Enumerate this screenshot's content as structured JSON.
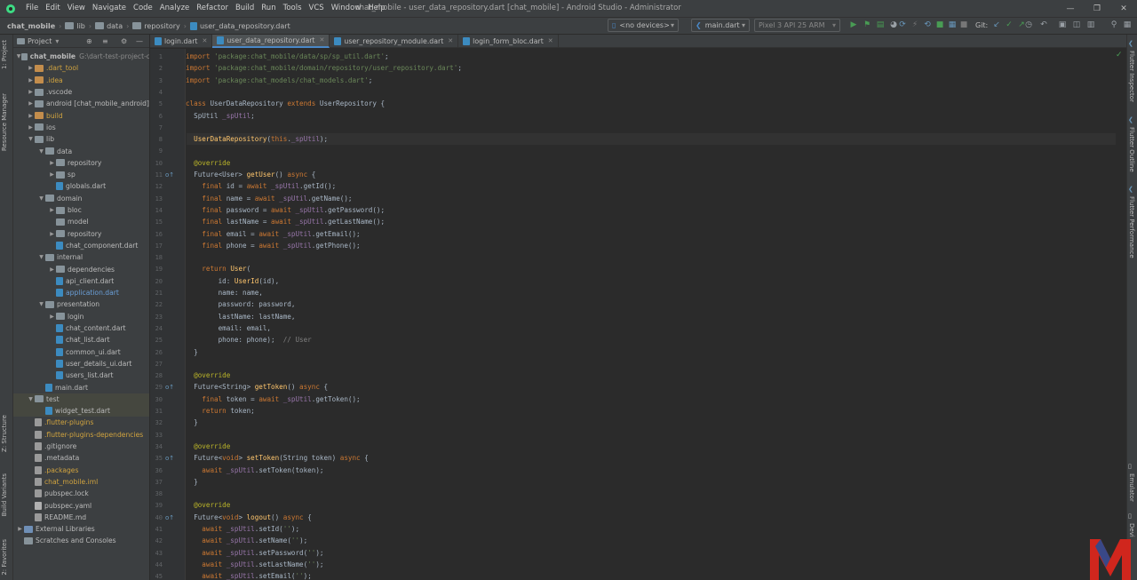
{
  "menubar": {
    "items": [
      "File",
      "Edit",
      "View",
      "Navigate",
      "Code",
      "Analyze",
      "Refactor",
      "Build",
      "Run",
      "Tools",
      "VCS",
      "Window",
      "Help"
    ],
    "title": "chat_mobile - user_data_repository.dart [chat_mobile] - Android Studio - Administrator"
  },
  "breadcrumb": [
    "chat_mobile",
    "lib",
    "data",
    "repository",
    "user_data_repository.dart"
  ],
  "toolbar": {
    "device_combo": "<no devices>",
    "config_combo": "main.dart",
    "avd_combo": "Pixel 3 API 25 ARM",
    "git_label": "Git:"
  },
  "project_panel": {
    "title": "Project",
    "tree": [
      {
        "label": "chat_mobile",
        "suffix": "G:\\dart-test-project-c",
        "indent": 0,
        "arrow": "down",
        "icon": "folder",
        "tone": "root"
      },
      {
        "label": ".dart_tool",
        "indent": 1,
        "arrow": "right",
        "icon": "folder-orange",
        "tone": "orange"
      },
      {
        "label": ".idea",
        "indent": 1,
        "arrow": "right",
        "icon": "folder-orange",
        "tone": "orange"
      },
      {
        "label": ".vscode",
        "indent": 1,
        "arrow": "right",
        "icon": "folder",
        "tone": "normal"
      },
      {
        "label": "android [chat_mobile_android]",
        "indent": 1,
        "arrow": "right",
        "icon": "folder",
        "tone": "normal"
      },
      {
        "label": "build",
        "indent": 1,
        "arrow": "right",
        "icon": "folder-orange",
        "tone": "orange"
      },
      {
        "label": "ios",
        "indent": 1,
        "arrow": "right",
        "icon": "folder",
        "tone": "normal"
      },
      {
        "label": "lib",
        "indent": 1,
        "arrow": "down",
        "icon": "folder",
        "tone": "normal"
      },
      {
        "label": "data",
        "indent": 2,
        "arrow": "down",
        "icon": "folder",
        "tone": "normal"
      },
      {
        "label": "repository",
        "indent": 3,
        "arrow": "right",
        "icon": "folder",
        "tone": "normal"
      },
      {
        "label": "sp",
        "indent": 3,
        "arrow": "right",
        "icon": "folder",
        "tone": "normal"
      },
      {
        "label": "globals.dart",
        "indent": 3,
        "arrow": "",
        "icon": "dart",
        "tone": "normal"
      },
      {
        "label": "domain",
        "indent": 2,
        "arrow": "down",
        "icon": "folder",
        "tone": "normal"
      },
      {
        "label": "bloc",
        "indent": 3,
        "arrow": "right",
        "icon": "folder",
        "tone": "normal"
      },
      {
        "label": "model",
        "indent": 3,
        "arrow": "",
        "icon": "folder",
        "tone": "normal"
      },
      {
        "label": "repository",
        "indent": 3,
        "arrow": "right",
        "icon": "folder",
        "tone": "normal"
      },
      {
        "label": "chat_component.dart",
        "indent": 3,
        "arrow": "",
        "icon": "dart",
        "tone": "normal"
      },
      {
        "label": "internal",
        "indent": 2,
        "arrow": "down",
        "icon": "folder",
        "tone": "normal"
      },
      {
        "label": "dependencies",
        "indent": 3,
        "arrow": "right",
        "icon": "folder",
        "tone": "normal"
      },
      {
        "label": "api_client.dart",
        "indent": 3,
        "arrow": "",
        "icon": "dart",
        "tone": "normal"
      },
      {
        "label": "application.dart",
        "indent": 3,
        "arrow": "",
        "icon": "dart",
        "tone": "blue"
      },
      {
        "label": "presentation",
        "indent": 2,
        "arrow": "down",
        "icon": "folder",
        "tone": "normal"
      },
      {
        "label": "login",
        "indent": 3,
        "arrow": "right",
        "icon": "folder",
        "tone": "normal"
      },
      {
        "label": "chat_content.dart",
        "indent": 3,
        "arrow": "",
        "icon": "dart",
        "tone": "normal"
      },
      {
        "label": "chat_list.dart",
        "indent": 3,
        "arrow": "",
        "icon": "dart",
        "tone": "normal"
      },
      {
        "label": "common_ui.dart",
        "indent": 3,
        "arrow": "",
        "icon": "dart",
        "tone": "normal"
      },
      {
        "label": "user_details_ui.dart",
        "indent": 3,
        "arrow": "",
        "icon": "dart",
        "tone": "normal"
      },
      {
        "label": "users_list.dart",
        "indent": 3,
        "arrow": "",
        "icon": "dart",
        "tone": "normal"
      },
      {
        "label": "main.dart",
        "indent": 2,
        "arrow": "",
        "icon": "dart",
        "tone": "normal"
      },
      {
        "label": "test",
        "indent": 1,
        "arrow": "down",
        "icon": "folder",
        "tone": "normal",
        "hl": true
      },
      {
        "label": "widget_test.dart",
        "indent": 2,
        "arrow": "",
        "icon": "dart",
        "tone": "normal",
        "hl": true
      },
      {
        "label": ".flutter-plugins",
        "indent": 1,
        "arrow": "",
        "icon": "gen",
        "tone": "orange"
      },
      {
        "label": ".flutter-plugins-dependencies",
        "indent": 1,
        "arrow": "",
        "icon": "gen",
        "tone": "orange"
      },
      {
        "label": ".gitignore",
        "indent": 1,
        "arrow": "",
        "icon": "gen",
        "tone": "normal"
      },
      {
        "label": ".metadata",
        "indent": 1,
        "arrow": "",
        "icon": "gen",
        "tone": "normal"
      },
      {
        "label": ".packages",
        "indent": 1,
        "arrow": "",
        "icon": "gen",
        "tone": "orange"
      },
      {
        "label": "chat_mobile.iml",
        "indent": 1,
        "arrow": "",
        "icon": "gen",
        "tone": "orange"
      },
      {
        "label": "pubspec.lock",
        "indent": 1,
        "arrow": "",
        "icon": "gen",
        "tone": "normal"
      },
      {
        "label": "pubspec.yaml",
        "indent": 1,
        "arrow": "",
        "icon": "yaml",
        "tone": "normal"
      },
      {
        "label": "README.md",
        "indent": 1,
        "arrow": "",
        "icon": "gen",
        "tone": "normal"
      },
      {
        "label": "External Libraries",
        "indent": 0,
        "arrow": "right",
        "icon": "lib",
        "tone": "normal"
      },
      {
        "label": "Scratches and Consoles",
        "indent": 0,
        "arrow": "",
        "icon": "scratch",
        "tone": "normal"
      }
    ]
  },
  "tabs": [
    {
      "label": "login.dart",
      "active": false
    },
    {
      "label": "user_data_repository.dart",
      "active": true
    },
    {
      "label": "user_repository_module.dart",
      "active": false
    },
    {
      "label": "login_form_bloc.dart",
      "active": false
    }
  ],
  "left_tool_tabs": [
    "1: Project",
    "Resource Manager",
    "Z: Structure",
    "Build Variants",
    "2: Favorites"
  ],
  "right_tool_tabs": [
    "Flutter Inspector",
    "Flutter Outline",
    "Flutter Performance",
    "Emulator",
    "Devi"
  ],
  "editor": {
    "current_line": 8,
    "gutter_markers": [
      11,
      29,
      35,
      40
    ],
    "lines": [
      [
        [
          "k",
          "import "
        ],
        [
          "s",
          "'package:chat_mobile/data/sp/sp_util.dart'"
        ],
        [
          "p",
          ";"
        ]
      ],
      [
        [
          "k",
          "import "
        ],
        [
          "s",
          "'package:chat_mobile/domain/repository/user_repository.dart'"
        ],
        [
          "p",
          ";"
        ]
      ],
      [
        [
          "k",
          "import "
        ],
        [
          "s",
          "'package:chat_models/chat_models.dart'"
        ],
        [
          "p",
          ";"
        ]
      ],
      [],
      [
        [
          "k",
          "class "
        ],
        [
          "p",
          "UserDataRepository "
        ],
        [
          "k",
          "extends "
        ],
        [
          "p",
          "UserRepository {"
        ]
      ],
      [
        [
          "p",
          "  SpUtil "
        ],
        [
          "fld",
          "_spUtil"
        ],
        [
          "p",
          ";"
        ]
      ],
      [],
      [
        [
          "p",
          "  "
        ],
        [
          "f",
          "UserDataRepository"
        ],
        [
          "p",
          "("
        ],
        [
          "k",
          "this"
        ],
        [
          "p",
          "."
        ],
        [
          "fld",
          "_spUtil"
        ],
        [
          "p",
          ");"
        ]
      ],
      [],
      [
        [
          "p",
          "  "
        ],
        [
          "a",
          "@override"
        ]
      ],
      [
        [
          "p",
          "  Future<User> "
        ],
        [
          "f",
          "getUser"
        ],
        [
          "p",
          "() "
        ],
        [
          "k",
          "async "
        ],
        [
          "p",
          "{"
        ]
      ],
      [
        [
          "p",
          "    "
        ],
        [
          "k",
          "final "
        ],
        [
          "p",
          "id = "
        ],
        [
          "k",
          "await "
        ],
        [
          "fld",
          "_spUtil"
        ],
        [
          "p",
          ".getId();"
        ]
      ],
      [
        [
          "p",
          "    "
        ],
        [
          "k",
          "final "
        ],
        [
          "p",
          "name = "
        ],
        [
          "k",
          "await "
        ],
        [
          "fld",
          "_spUtil"
        ],
        [
          "p",
          ".getName();"
        ]
      ],
      [
        [
          "p",
          "    "
        ],
        [
          "k",
          "final "
        ],
        [
          "p",
          "password = "
        ],
        [
          "k",
          "await "
        ],
        [
          "fld",
          "_spUtil"
        ],
        [
          "p",
          ".getPassword();"
        ]
      ],
      [
        [
          "p",
          "    "
        ],
        [
          "k",
          "final "
        ],
        [
          "p",
          "lastName = "
        ],
        [
          "k",
          "await "
        ],
        [
          "fld",
          "_spUtil"
        ],
        [
          "p",
          ".getLastName();"
        ]
      ],
      [
        [
          "p",
          "    "
        ],
        [
          "k",
          "final "
        ],
        [
          "p",
          "email = "
        ],
        [
          "k",
          "await "
        ],
        [
          "fld",
          "_spUtil"
        ],
        [
          "p",
          ".getEmail();"
        ]
      ],
      [
        [
          "p",
          "    "
        ],
        [
          "k",
          "final "
        ],
        [
          "p",
          "phone = "
        ],
        [
          "k",
          "await "
        ],
        [
          "fld",
          "_spUtil"
        ],
        [
          "p",
          ".getPhone();"
        ]
      ],
      [],
      [
        [
          "p",
          "    "
        ],
        [
          "k",
          "return "
        ],
        [
          "f",
          "User"
        ],
        [
          "p",
          "("
        ]
      ],
      [
        [
          "p",
          "        id: "
        ],
        [
          "f",
          "UserId"
        ],
        [
          "p",
          "(id),"
        ]
      ],
      [
        [
          "p",
          "        name: name,"
        ]
      ],
      [
        [
          "p",
          "        password: password,"
        ]
      ],
      [
        [
          "p",
          "        lastName: lastName,"
        ]
      ],
      [
        [
          "p",
          "        email: email,"
        ]
      ],
      [
        [
          "p",
          "        phone: phone);  "
        ],
        [
          "cm",
          "// User"
        ]
      ],
      [
        [
          "p",
          "  }"
        ]
      ],
      [],
      [
        [
          "p",
          "  "
        ],
        [
          "a",
          "@override"
        ]
      ],
      [
        [
          "p",
          "  Future<String> "
        ],
        [
          "f",
          "getToken"
        ],
        [
          "p",
          "() "
        ],
        [
          "k",
          "async "
        ],
        [
          "p",
          "{"
        ]
      ],
      [
        [
          "p",
          "    "
        ],
        [
          "k",
          "final "
        ],
        [
          "p",
          "token = "
        ],
        [
          "k",
          "await "
        ],
        [
          "fld",
          "_spUtil"
        ],
        [
          "p",
          ".getToken();"
        ]
      ],
      [
        [
          "p",
          "    "
        ],
        [
          "k",
          "return "
        ],
        [
          "p",
          "token;"
        ]
      ],
      [
        [
          "p",
          "  }"
        ]
      ],
      [],
      [
        [
          "p",
          "  "
        ],
        [
          "a",
          "@override"
        ]
      ],
      [
        [
          "p",
          "  Future<"
        ],
        [
          "k",
          "void"
        ],
        [
          "p",
          "> "
        ],
        [
          "f",
          "setToken"
        ],
        [
          "p",
          "(String token) "
        ],
        [
          "k",
          "async "
        ],
        [
          "p",
          "{"
        ]
      ],
      [
        [
          "p",
          "    "
        ],
        [
          "k",
          "await "
        ],
        [
          "fld",
          "_spUtil"
        ],
        [
          "p",
          ".setToken(token);"
        ]
      ],
      [
        [
          "p",
          "  }"
        ]
      ],
      [],
      [
        [
          "p",
          "  "
        ],
        [
          "a",
          "@override"
        ]
      ],
      [
        [
          "p",
          "  Future<"
        ],
        [
          "k",
          "void"
        ],
        [
          "p",
          "> "
        ],
        [
          "f",
          "logout"
        ],
        [
          "p",
          "() "
        ],
        [
          "k",
          "async "
        ],
        [
          "p",
          "{"
        ]
      ],
      [
        [
          "p",
          "    "
        ],
        [
          "k",
          "await "
        ],
        [
          "fld",
          "_spUtil"
        ],
        [
          "p",
          ".setId("
        ],
        [
          "s",
          "''"
        ],
        [
          "p",
          ");"
        ]
      ],
      [
        [
          "p",
          "    "
        ],
        [
          "k",
          "await "
        ],
        [
          "fld",
          "_spUtil"
        ],
        [
          "p",
          ".setName("
        ],
        [
          "s",
          "''"
        ],
        [
          "p",
          ");"
        ]
      ],
      [
        [
          "p",
          "    "
        ],
        [
          "k",
          "await "
        ],
        [
          "fld",
          "_spUtil"
        ],
        [
          "p",
          ".setPassword("
        ],
        [
          "s",
          "''"
        ],
        [
          "p",
          ");"
        ]
      ],
      [
        [
          "p",
          "    "
        ],
        [
          "k",
          "await "
        ],
        [
          "fld",
          "_spUtil"
        ],
        [
          "p",
          ".setLastName("
        ],
        [
          "s",
          "''"
        ],
        [
          "p",
          ");"
        ]
      ],
      [
        [
          "p",
          "    "
        ],
        [
          "k",
          "await "
        ],
        [
          "fld",
          "_spUtil"
        ],
        [
          "p",
          ".setEmail("
        ],
        [
          "s",
          "''"
        ],
        [
          "p",
          ");"
        ]
      ]
    ]
  },
  "colors": {
    "accent": "#4a88c7",
    "keyword": "#cc7832",
    "string": "#6a8759",
    "annotation": "#bbb529",
    "function": "#ffc66d",
    "field": "#9876aa",
    "logo_red": "#d0261d",
    "logo_blue": "#1e4f9a"
  }
}
